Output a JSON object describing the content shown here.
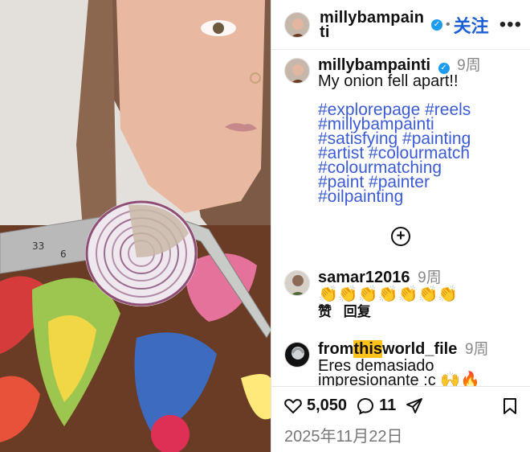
{
  "header": {
    "username": "millybampainti",
    "separator": "•",
    "follow_label": "关注",
    "more_icon": "more-icon"
  },
  "caption": {
    "username": "millybampainti",
    "time": "9周",
    "text": "My onion fell apart!!",
    "hashtags": [
      "#explorepage #reels",
      "#millybampainti",
      "#satisfying #painting",
      "#artist #colourmatch",
      "#colourmatching",
      "#paint #painter",
      "#oilpainting"
    ],
    "load_more_icon": "plus-circle-icon"
  },
  "comments": [
    {
      "username": "samar12016",
      "time": "9周",
      "text": "👏👏👏👏👏👏👏",
      "like_label": "赞",
      "reply_label": "回复"
    },
    {
      "username_parts": [
        "from",
        "this",
        "world_file"
      ],
      "time": "9周",
      "text": "Eres demasiado impresionante :c 🙌🔥",
      "extra": "❤️"
    }
  ],
  "footer": {
    "likes": "5,050",
    "comments": "11",
    "date": "2025年11月22日"
  },
  "colors": {
    "accent": "#1d5fd6",
    "hashtag": "#3b5bd6",
    "verified": "#1d9bf0",
    "highlight": "#ffc21a"
  }
}
